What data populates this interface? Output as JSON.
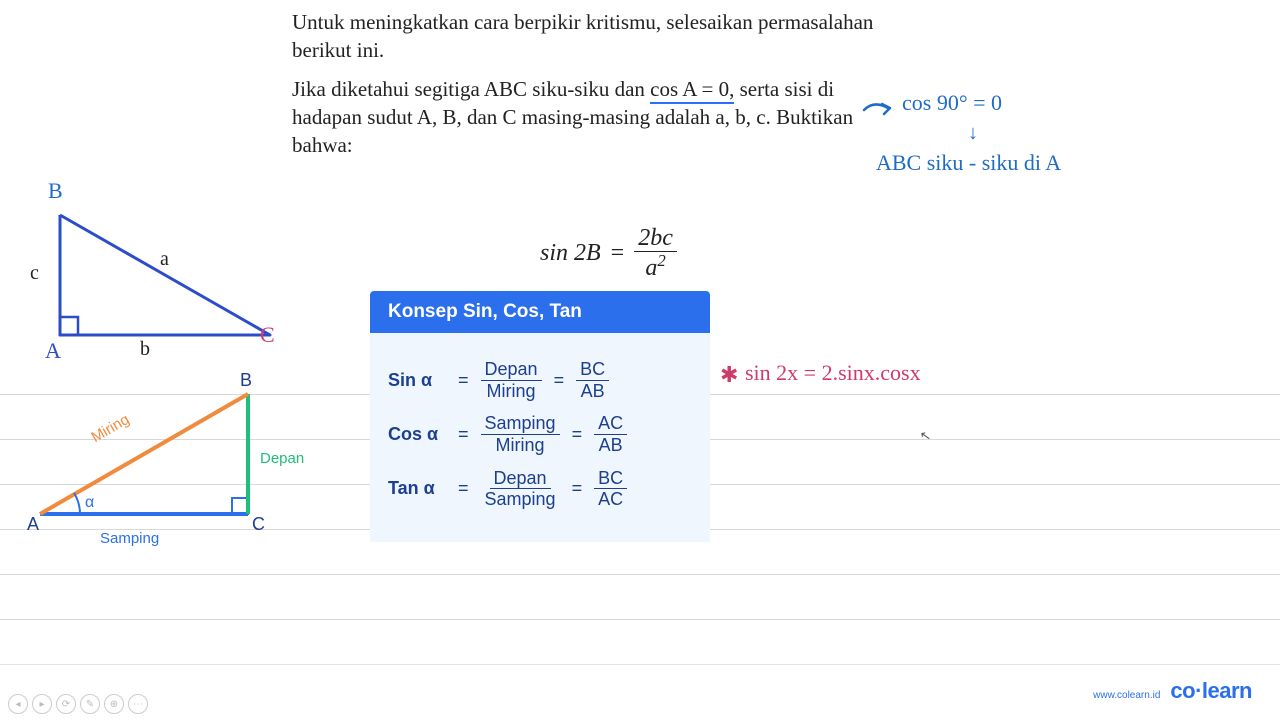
{
  "question": {
    "p1": "Untuk meningkatkan cara berpikir kritismu, selesaikan permasalahan berikut ini.",
    "p2_a": "Jika diketahui segitiga ABC siku-siku dan ",
    "p2_u": "cos A = 0,",
    "p2_b": " serta sisi di hadapan sudut A, B, dan C masing-masing adalah a, b, c. Buktikan bahwa:"
  },
  "equation": {
    "lhs": "sin 2B",
    "eq": "=",
    "num": "2bc",
    "den_base": "a",
    "den_exp": "2"
  },
  "concept": {
    "title": "Konsep Sin, Cos, Tan",
    "rows": [
      {
        "label": "Sin α",
        "topA": "Depan",
        "botA": "Miring",
        "topB": "BC",
        "botB": "AB"
      },
      {
        "label": "Cos α",
        "topA": "Samping",
        "botA": "Miring",
        "topB": "AC",
        "botB": "AB"
      },
      {
        "label": "Tan α",
        "topA": "Depan",
        "botA": "Samping",
        "topB": "BC",
        "botB": "AC"
      }
    ]
  },
  "handwriting": {
    "cos90": "cos 90° = 0",
    "arrow_down": "↓",
    "siku": "ABC siku - siku di A",
    "sin2x_star": "✱",
    "sin2x": "sin 2x = 2.sinx.cosx"
  },
  "triangle1": {
    "B": "B",
    "A": "A",
    "C": "C",
    "a": "a",
    "b": "b",
    "c": "c"
  },
  "triangle2": {
    "A": "A",
    "B": "B",
    "C": "C",
    "miring": "Miring",
    "depan": "Depan",
    "samping": "Samping",
    "alpha": "α"
  },
  "footer": {
    "url": "www.colearn.id",
    "brand_a": "co",
    "brand_dot": "·",
    "brand_b": "learn"
  },
  "controls": {
    "back": "◂",
    "play": "▸",
    "speed": "⟳",
    "pen": "✎",
    "zoom": "⊕",
    "more": "⋯"
  }
}
